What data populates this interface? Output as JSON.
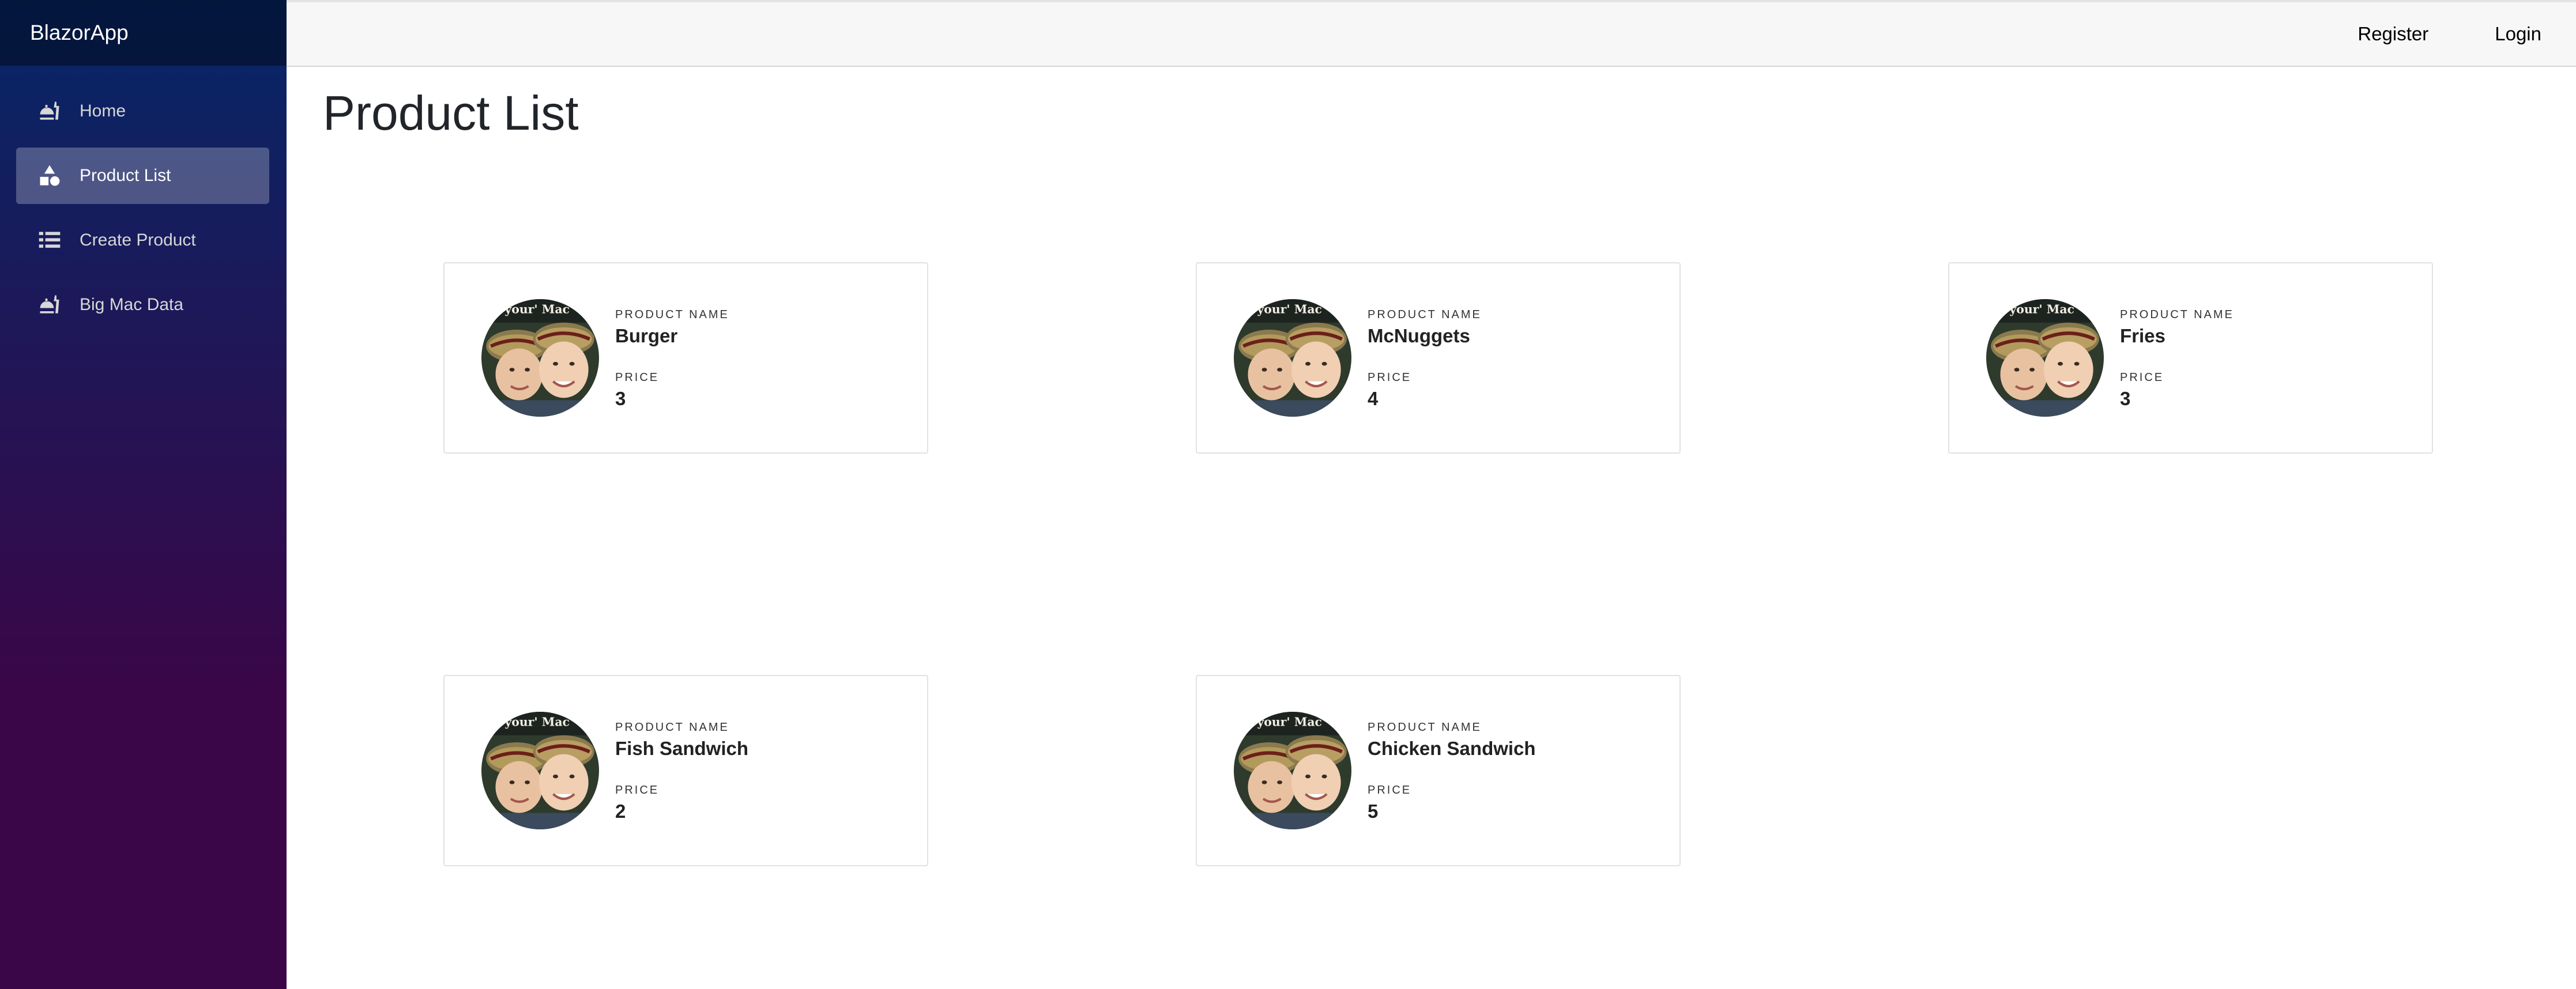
{
  "app": {
    "brand": "BlazorApp"
  },
  "sidebar": {
    "items": [
      {
        "label": "Home",
        "icon": "food-icon",
        "active": false
      },
      {
        "label": "Product List",
        "icon": "shapes-icon",
        "active": true
      },
      {
        "label": "Create Product",
        "icon": "list-icon",
        "active": false
      },
      {
        "label": "Big Mac Data",
        "icon": "food-icon",
        "active": false
      }
    ]
  },
  "topbar": {
    "register": "Register",
    "login": "Login"
  },
  "page": {
    "title": "Product List"
  },
  "products": [
    {
      "name_label": "PRODUCT NAME",
      "name": "Burger",
      "price_label": "PRICE",
      "price": "3"
    },
    {
      "name_label": "PRODUCT NAME",
      "name": "McNuggets",
      "price_label": "PRICE",
      "price": "4"
    },
    {
      "name_label": "PRODUCT NAME",
      "name": "Fries",
      "price_label": "PRICE",
      "price": "3"
    },
    {
      "name_label": "PRODUCT NAME",
      "name": "Fish Sandwich",
      "price_label": "PRICE",
      "price": "2"
    },
    {
      "name_label": "PRODUCT NAME",
      "name": "Chicken Sandwich",
      "price_label": "PRICE",
      "price": "5"
    }
  ],
  "colors": {
    "sidebar_top": "#052767",
    "sidebar_bottom": "#3a0647",
    "active_item": "rgba(255,255,255,0.25)"
  }
}
